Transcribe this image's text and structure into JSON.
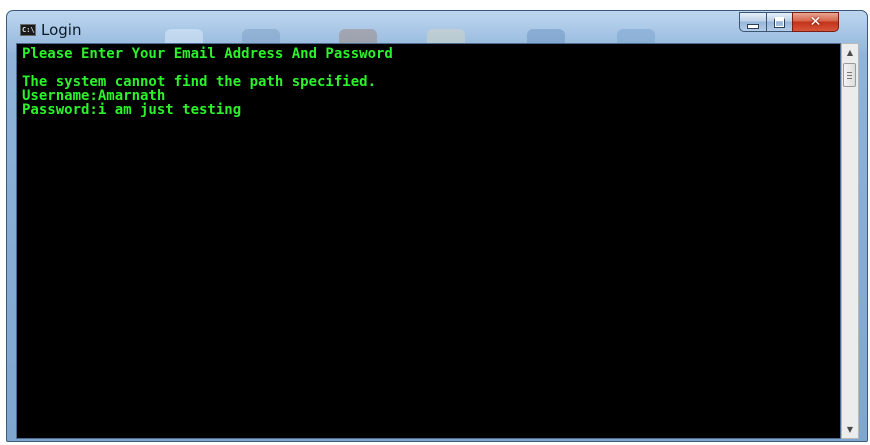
{
  "window": {
    "title": "Login",
    "icon": "console-icon",
    "controls": {
      "minimize": "minimize-icon",
      "maximize": "maximize-icon",
      "close": "close-icon"
    }
  },
  "console": {
    "lines": [
      "Please Enter Your Email Address And Password",
      "",
      "The system cannot find the path specified.",
      "Username:Amarnath",
      "Password:i am just testing"
    ],
    "text_color": "#2cf22c",
    "background": "#000000"
  },
  "scrollbar": {
    "up": "scroll-up-arrow-icon",
    "down": "scroll-down-arrow-icon"
  }
}
